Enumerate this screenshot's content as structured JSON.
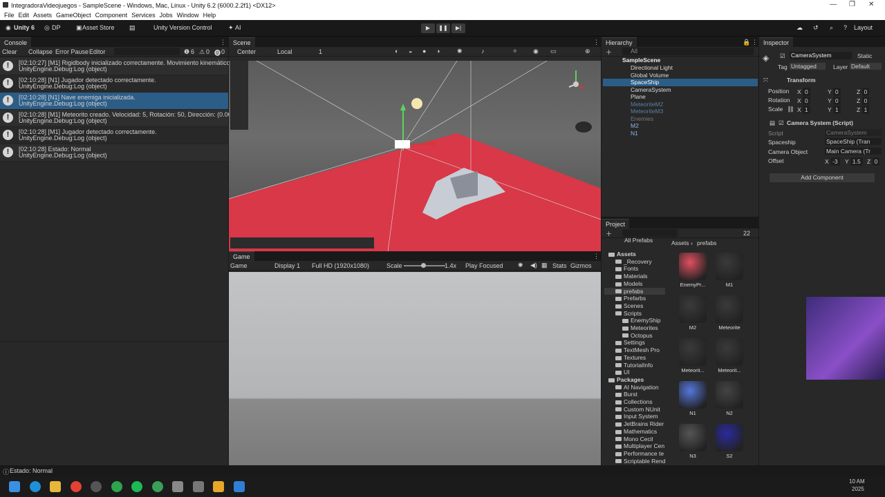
{
  "window": {
    "title": "IntegradoraVideojuegos - SampleScene - Windows, Mac, Linux - Unity 6.2 (6000.2.2f1) <DX12>"
  },
  "menu": [
    "File",
    "Edit",
    "Assets",
    "GameObject",
    "Component",
    "Services",
    "Jobs",
    "Window",
    "Help"
  ],
  "toolbar": {
    "account": "Unity 6",
    "dp": "DP",
    "asset_store": "Asset Store",
    "version_control": "Unity Version Control",
    "ai": "AI",
    "layout": "Layout"
  },
  "console": {
    "tab": "Console",
    "clear": "Clear",
    "collapse": "Collapse",
    "error_pause": "Error Pause",
    "editor": "Editor",
    "count_log": "6",
    "count_warn": "0",
    "count_err": "0",
    "logs": [
      {
        "l1": "[02:10:27] [M1] Rigidbody inicializado correctamente. Movimiento kinemático acti",
        "l2": "UnityEngine.Debug:Log (object)"
      },
      {
        "l1": "[02:10:28] [N1] Jugador detectado correctamente.",
        "l2": "UnityEngine.Debug:Log (object)"
      },
      {
        "l1": "[02:10:28] [N1] Nave enemiga inicializada.",
        "l2": "UnityEngine.Debug:Log (object)"
      },
      {
        "l1": "[02:10:28] [M1] Meteorito creado. Velocidad: 5, Rotación: 50, Dirección: (0.00, 0.0",
        "l2": "UnityEngine.Debug:Log (object)"
      },
      {
        "l1": "[02:10:28] [M1] Jugador detectado correctamente.",
        "l2": "UnityEngine.Debug:Log (object)"
      },
      {
        "l1": "[02:10:28] Estado: Normal",
        "l2": "UnityEngine.Debug:Log (object)"
      }
    ]
  },
  "status": {
    "text": "Estado: Normal"
  },
  "scene": {
    "tab": "Scene",
    "pivot": "Center",
    "space": "Local",
    "grid": "1"
  },
  "game": {
    "tab": "Game",
    "mode": "Game",
    "display": "Display 1",
    "resolution": "Full HD (1920x1080)",
    "scale_label": "Scale",
    "scale_value": "1.4x",
    "play_focused": "Play Focused",
    "stats": "Stats",
    "gizmos": "Gizmos"
  },
  "hierarchy": {
    "tab": "Hierarchy",
    "search": "All",
    "items": [
      {
        "label": "SampleScene",
        "indent": 0
      },
      {
        "label": "Directional Light",
        "indent": 1
      },
      {
        "label": "Global Volume",
        "indent": 1
      },
      {
        "label": "SpaceShip",
        "indent": 1,
        "selected": true
      },
      {
        "label": "CameraSystem",
        "indent": 1
      },
      {
        "label": "Plane",
        "indent": 1
      },
      {
        "label": "MeteoriteM2",
        "indent": 1,
        "prefab": true,
        "dim": true
      },
      {
        "label": "MeteoriteM3",
        "indent": 1,
        "prefab": true,
        "dim": true
      },
      {
        "label": "Enemies",
        "indent": 1,
        "dim": true
      },
      {
        "label": "M2",
        "indent": 1,
        "prefab": true
      },
      {
        "label": "N1",
        "indent": 1,
        "prefab": true
      }
    ]
  },
  "inspector": {
    "tab": "Inspector",
    "object": "CameraSystem",
    "static": "Static",
    "tag_label": "Tag",
    "tag": "Untagged",
    "layer_label": "Layer",
    "layer": "Default",
    "transform": {
      "title": "Transform",
      "position": [
        "0",
        "0",
        "0"
      ],
      "rotation": [
        "0",
        "0",
        "0"
      ],
      "scale": [
        "1",
        "1",
        "1"
      ],
      "labels": [
        "Position",
        "Rotation",
        "Scale"
      ]
    },
    "script": {
      "title": "Camera System (Script)",
      "script_label": "Script",
      "script_value": "CameraSystem",
      "spaceship_label": "Spaceship",
      "spaceship_value": "SpaceShip (Tran",
      "camobj_label": "Camera Object",
      "camobj_value": "Main Camera (Tr",
      "offset_label": "Offset",
      "offset": [
        "-3",
        "1.5",
        "0"
      ]
    },
    "add_component": "Add Component"
  },
  "project": {
    "tab": "Project",
    "count": "22",
    "breadcrumb_root": "Assets",
    "breadcrumb_leaf": "prefabs",
    "all_prefabs": "All Prefabs",
    "tree": [
      {
        "label": "Assets",
        "indent": 0,
        "bold": true
      },
      {
        "label": "_Recovery",
        "indent": 1
      },
      {
        "label": "Fonts",
        "indent": 1
      },
      {
        "label": "Materials",
        "indent": 1
      },
      {
        "label": "Models",
        "indent": 1
      },
      {
        "label": "prefabs",
        "indent": 1,
        "selected": true
      },
      {
        "label": "Prefarbs",
        "indent": 1
      },
      {
        "label": "Scenes",
        "indent": 1
      },
      {
        "label": "Scripts",
        "indent": 1
      },
      {
        "label": "EnemyShip",
        "indent": 2
      },
      {
        "label": "Meteorites",
        "indent": 2
      },
      {
        "label": "Octopus",
        "indent": 2
      },
      {
        "label": "Settings",
        "indent": 1
      },
      {
        "label": "TextMesh Pro",
        "indent": 1
      },
      {
        "label": "Textures",
        "indent": 1
      },
      {
        "label": "TutorialInfo",
        "indent": 1
      },
      {
        "label": "UI",
        "indent": 1
      },
      {
        "label": "Packages",
        "indent": 0,
        "bold": true
      },
      {
        "label": "AI Navigation",
        "indent": 1
      },
      {
        "label": "Burst",
        "indent": 1
      },
      {
        "label": "Collections",
        "indent": 1
      },
      {
        "label": "Custom NUnit",
        "indent": 1
      },
      {
        "label": "Input System",
        "indent": 1
      },
      {
        "label": "JetBrains Rider",
        "indent": 1
      },
      {
        "label": "Mathematics",
        "indent": 1
      },
      {
        "label": "Mono Cecil",
        "indent": 1
      },
      {
        "label": "Multiplayer Cen",
        "indent": 1
      },
      {
        "label": "Performance te",
        "indent": 1
      },
      {
        "label": "Scriptable Rend",
        "indent": 1
      }
    ],
    "assets": [
      {
        "label": "EnemyPr...",
        "color": "#e05060"
      },
      {
        "label": "M1",
        "color": "#3a3a3a"
      },
      {
        "label": "M2",
        "color": "#3a3a3a"
      },
      {
        "label": "Meteorite",
        "color": "#3a3a3a"
      },
      {
        "label": "Meteorit...",
        "color": "#3a3a3a"
      },
      {
        "label": "Meteorit...",
        "color": "#3a3a3a"
      },
      {
        "label": "N1",
        "color": "#5577dd"
      },
      {
        "label": "N2",
        "color": "#444444"
      },
      {
        "label": "N3",
        "color": "#555555"
      },
      {
        "label": "S2",
        "color": "#2a2aa0"
      }
    ]
  },
  "taskbar": {
    "time": "10 AM",
    "year": "2025"
  },
  "colors": {
    "accent": "#2c5d87",
    "red_plane": "#d83848"
  }
}
